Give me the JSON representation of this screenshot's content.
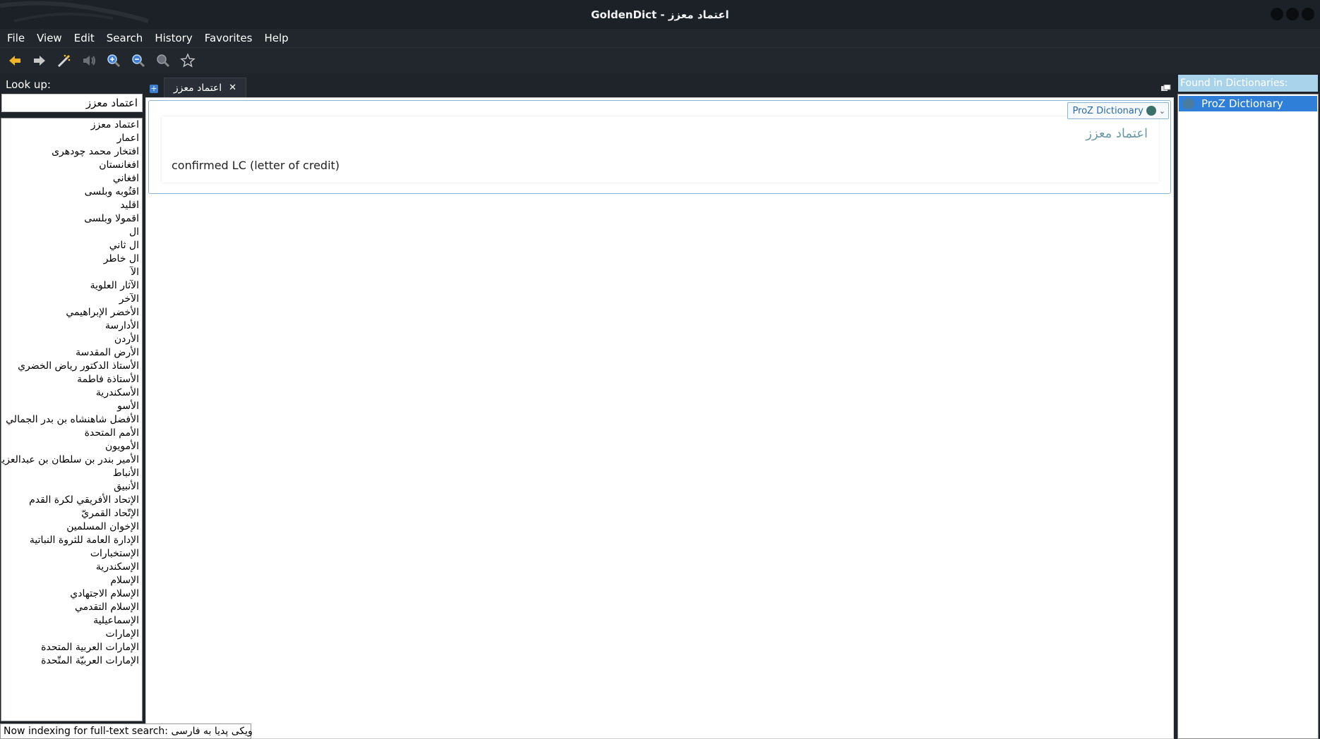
{
  "window": {
    "title": "GoldenDict - اعتماد معزز"
  },
  "menu": [
    "File",
    "View",
    "Edit",
    "Search",
    "History",
    "Favorites",
    "Help"
  ],
  "toolbar": {
    "icons": [
      "back-arrow-icon",
      "forward-arrow-icon",
      "scan-wand-icon",
      "speaker-icon",
      "zoom-in-icon",
      "zoom-out-icon",
      "zoom-reset-icon",
      "favorite-star-icon"
    ]
  },
  "lookup": {
    "label": "Look up:",
    "value": "اعتماد معزز"
  },
  "wordlist": [
    "اعتماد معزز",
    "اعمار",
    "افتخار محمد چودهرى",
    "افغانستان",
    "افغاني",
    "اقتُوبه وبلسى",
    "اقليد",
    "اقمولا وبلسى",
    "ال",
    "ال ثاني",
    "ال خاطر",
    "الآ",
    "الآثار العلوية",
    "الآخر",
    "الأخضر الإبراهيمي",
    "الأدارسة",
    "الأردن",
    "الأرض المقدسة",
    "الأستاذ الدكتور رياض الخضري",
    "الأستاذة فاطمة",
    "الأسكندرية",
    "الأسو",
    "الأفضل شاهنشاه بن بدر الجمالي",
    "الأمم المتحدة",
    "الأمويون",
    "الأمير بندر بن سلطان بن عبدالعزيز",
    "الأنباط",
    "الأنبيق",
    "الإتحاد الأفريقي لكرة القدم",
    "الإتّحاد القمريّ",
    "الإخوان المسلمين",
    "الإدارة العامة للثروة النباتية",
    "الإستخبارات",
    "الإسكندرية",
    "الإسلام",
    "الإسلام الاجتهادي",
    "الإسلام التقدمي",
    "الإسماعيلية",
    "الإمارات",
    "الإمارات العربية المتحدة",
    "الإمارات العربيّة المتّحدة"
  ],
  "tab": {
    "label": "اعتماد معزز",
    "close": "✕"
  },
  "article": {
    "dictionary": "ProZ Dictionary",
    "headword": "اعتماد معزز",
    "definition": "confirmed LC (letter of credit)"
  },
  "found": {
    "header": "Found in Dictionaries:",
    "items": [
      "ProZ Dictionary"
    ]
  },
  "status": {
    "text": "Now indexing for full-text search: ویکی پدیا به فارسی"
  }
}
